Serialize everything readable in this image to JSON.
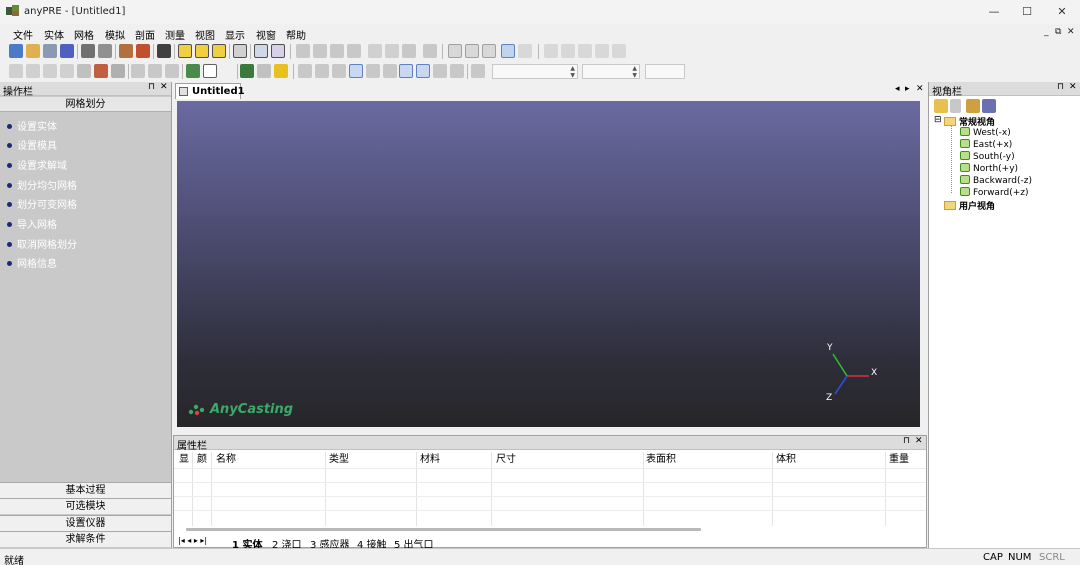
{
  "window": {
    "title": "anyPRE - [Untitled1]",
    "minimize": "—",
    "maximize": "☐",
    "close": "✕"
  },
  "menu": [
    "文件",
    "实体",
    "网格",
    "模拟",
    "剖面",
    "测量",
    "视图",
    "显示",
    "视窗",
    "帮助"
  ],
  "mdi": {
    "minimize": "_",
    "restore": "⧉",
    "close": "✕"
  },
  "left_panel": {
    "title": "操作栏",
    "section": "网格划分",
    "items": [
      "设置实体",
      "设置模具",
      "设置求解域",
      "划分均匀网格",
      "划分可变网格",
      "导入网格",
      "取消网格划分",
      "网格信息"
    ],
    "bottom_buttons": [
      "基本过程",
      "可选模块",
      "设置仪器",
      "求解条件"
    ]
  },
  "panel_controls": {
    "pin": "⊓",
    "close": "✕"
  },
  "document": {
    "tab": "Untitled1",
    "nav_prev": "◂",
    "nav_next": "▸",
    "close": "✕"
  },
  "viewport": {
    "logo": "AnyCasting",
    "axes": {
      "x": "X",
      "y": "Y",
      "z": "Z"
    }
  },
  "property_panel": {
    "title": "属性栏",
    "columns": [
      "显",
      "颜",
      "名称",
      "类型",
      "材料",
      "尺寸",
      "表面积",
      "体积",
      "重量"
    ],
    "tabs": [
      "1 实体",
      "2 浇口",
      "3 感应器",
      "4 接触",
      "5 出气口"
    ]
  },
  "right_panel": {
    "title": "视角栏",
    "groups": [
      {
        "label": "常规视角",
        "expander": "⊟",
        "children": [
          "West(-x)",
          "East(+x)",
          "South(-y)",
          "North(+y)",
          "Backward(-z)",
          "Forward(+z)"
        ]
      },
      {
        "label": "用户视角",
        "children": []
      }
    ]
  },
  "status": {
    "text": "就绪",
    "indicators": [
      "CAP",
      "NUM",
      "SCRL"
    ]
  },
  "colors": {
    "accent_blue": "#1a2a7a",
    "viewport_top": "#6a6aa0",
    "viewport_bottom": "#262628",
    "logo_green": "#3aaa6a"
  }
}
